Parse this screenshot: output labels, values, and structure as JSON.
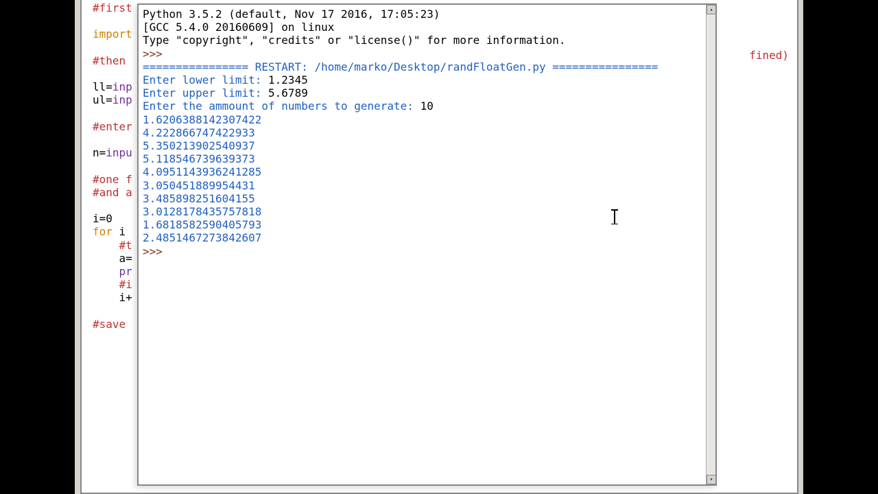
{
  "editor": {
    "lines": [
      {
        "class": "comment",
        "text": "#first"
      },
      {
        "class": "",
        "text": ""
      },
      {
        "class": "",
        "text": "import",
        "spans": [
          {
            "class": "keyword",
            "text": "import"
          }
        ]
      },
      {
        "class": "",
        "text": ""
      },
      {
        "class": "comment",
        "text": "#then "
      },
      {
        "class": "",
        "text": ""
      },
      {
        "class": "",
        "text": "ll=inp",
        "spans": [
          {
            "class": "",
            "text": "ll="
          },
          {
            "class": "builtin",
            "text": "inp"
          }
        ]
      },
      {
        "class": "",
        "text": "ul=inp",
        "spans": [
          {
            "class": "",
            "text": "ul="
          },
          {
            "class": "builtin",
            "text": "inp"
          }
        ]
      },
      {
        "class": "",
        "text": ""
      },
      {
        "class": "comment",
        "text": "#enter"
      },
      {
        "class": "",
        "text": ""
      },
      {
        "class": "",
        "text": "n=inpu",
        "spans": [
          {
            "class": "",
            "text": "n="
          },
          {
            "class": "builtin",
            "text": "inpu"
          }
        ]
      },
      {
        "class": "",
        "text": ""
      },
      {
        "class": "comment",
        "text": "#one f"
      },
      {
        "class": "comment",
        "text": "#and a"
      },
      {
        "class": "",
        "text": ""
      },
      {
        "class": "",
        "text": "i=0"
      },
      {
        "class": "",
        "text": "for i ",
        "spans": [
          {
            "class": "keyword",
            "text": "for"
          },
          {
            "class": "",
            "text": " i "
          }
        ]
      },
      {
        "class": "",
        "text": "    #t",
        "spans": [
          {
            "class": "",
            "text": "    "
          },
          {
            "class": "comment",
            "text": "#t"
          }
        ]
      },
      {
        "class": "",
        "text": "    a="
      },
      {
        "class": "",
        "text": "    pr",
        "spans": [
          {
            "class": "",
            "text": "    "
          },
          {
            "class": "builtin",
            "text": "pr"
          }
        ]
      },
      {
        "class": "",
        "text": "    #i",
        "spans": [
          {
            "class": "",
            "text": "    "
          },
          {
            "class": "comment",
            "text": "#i"
          }
        ]
      },
      {
        "class": "",
        "text": "    i+"
      },
      {
        "class": "",
        "text": ""
      },
      {
        "class": "comment",
        "text": "#save"
      }
    ],
    "trailing_hint": "fined)"
  },
  "shell": {
    "banner1": "Python 3.5.2 (default, Nov 17 2016, 17:05:23) ",
    "banner2": "[GCC 5.4.0 20160609] on linux",
    "banner3": "Type \"copyright\", \"credits\" or \"license()\" for more information.",
    "prompt": ">>> ",
    "restart": "================ RESTART: /home/marko/Desktop/randFloatGen.py ================",
    "inputs": [
      {
        "prompt": "Enter lower limit: ",
        "value": "1.2345"
      },
      {
        "prompt": "Enter upper limit: ",
        "value": "5.6789"
      },
      {
        "prompt": "Enter the ammount of numbers to generate: ",
        "value": "10"
      }
    ],
    "outputs": [
      "1.6206388142307422",
      "4.222866747422933",
      "5.350213902540937",
      "5.118546739639373",
      "4.0951143936241285",
      "3.050451889954431",
      "3.485898251604155",
      "3.0128178435757818",
      "1.6818582590405793",
      "2.4851467273842607"
    ]
  }
}
